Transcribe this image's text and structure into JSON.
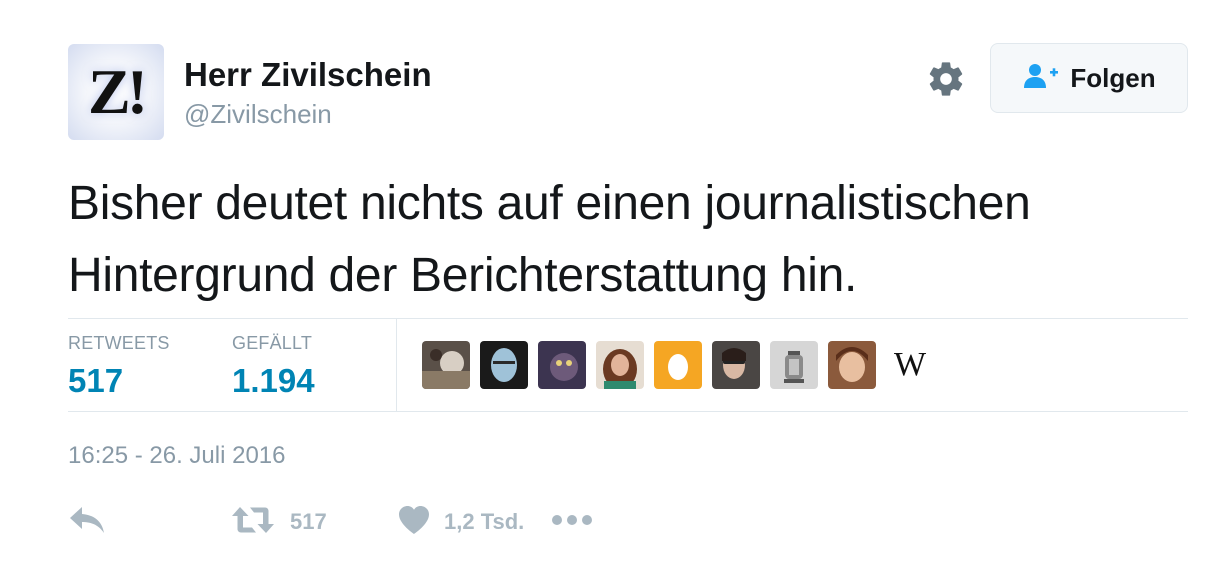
{
  "tweet": {
    "author_name": "Herr Zivilschein",
    "author_handle": "@Zivilschein",
    "avatar_text": "Z!",
    "text": "Bisher deutet nichts auf einen journalistischen Hintergrund der Berichterstattung hin.",
    "timestamp": "16:25 - 26. Juli 2016"
  },
  "header": {
    "follow_label": "Folgen",
    "follow_icon": "person-plus-icon",
    "settings_icon": "gear-icon"
  },
  "stats": {
    "retweets_label": "RETWEETS",
    "retweets_value": "517",
    "likes_label": "GEFÄLLT",
    "likes_value": "1.194"
  },
  "likers": {
    "wiki_letter": "W"
  },
  "actions": {
    "reply_icon": "reply-icon",
    "retweet_icon": "retweet-icon",
    "retweet_count": "517",
    "like_icon": "heart-icon",
    "like_count": "1,2 Tsd.",
    "more_icon": "more-icon"
  },
  "colors": {
    "accent": "#0084b4",
    "follow_icon": "#1da1f2",
    "muted": "#8899a6",
    "action_grey": "#aab8c2",
    "egg_bg": "#f5a623"
  }
}
